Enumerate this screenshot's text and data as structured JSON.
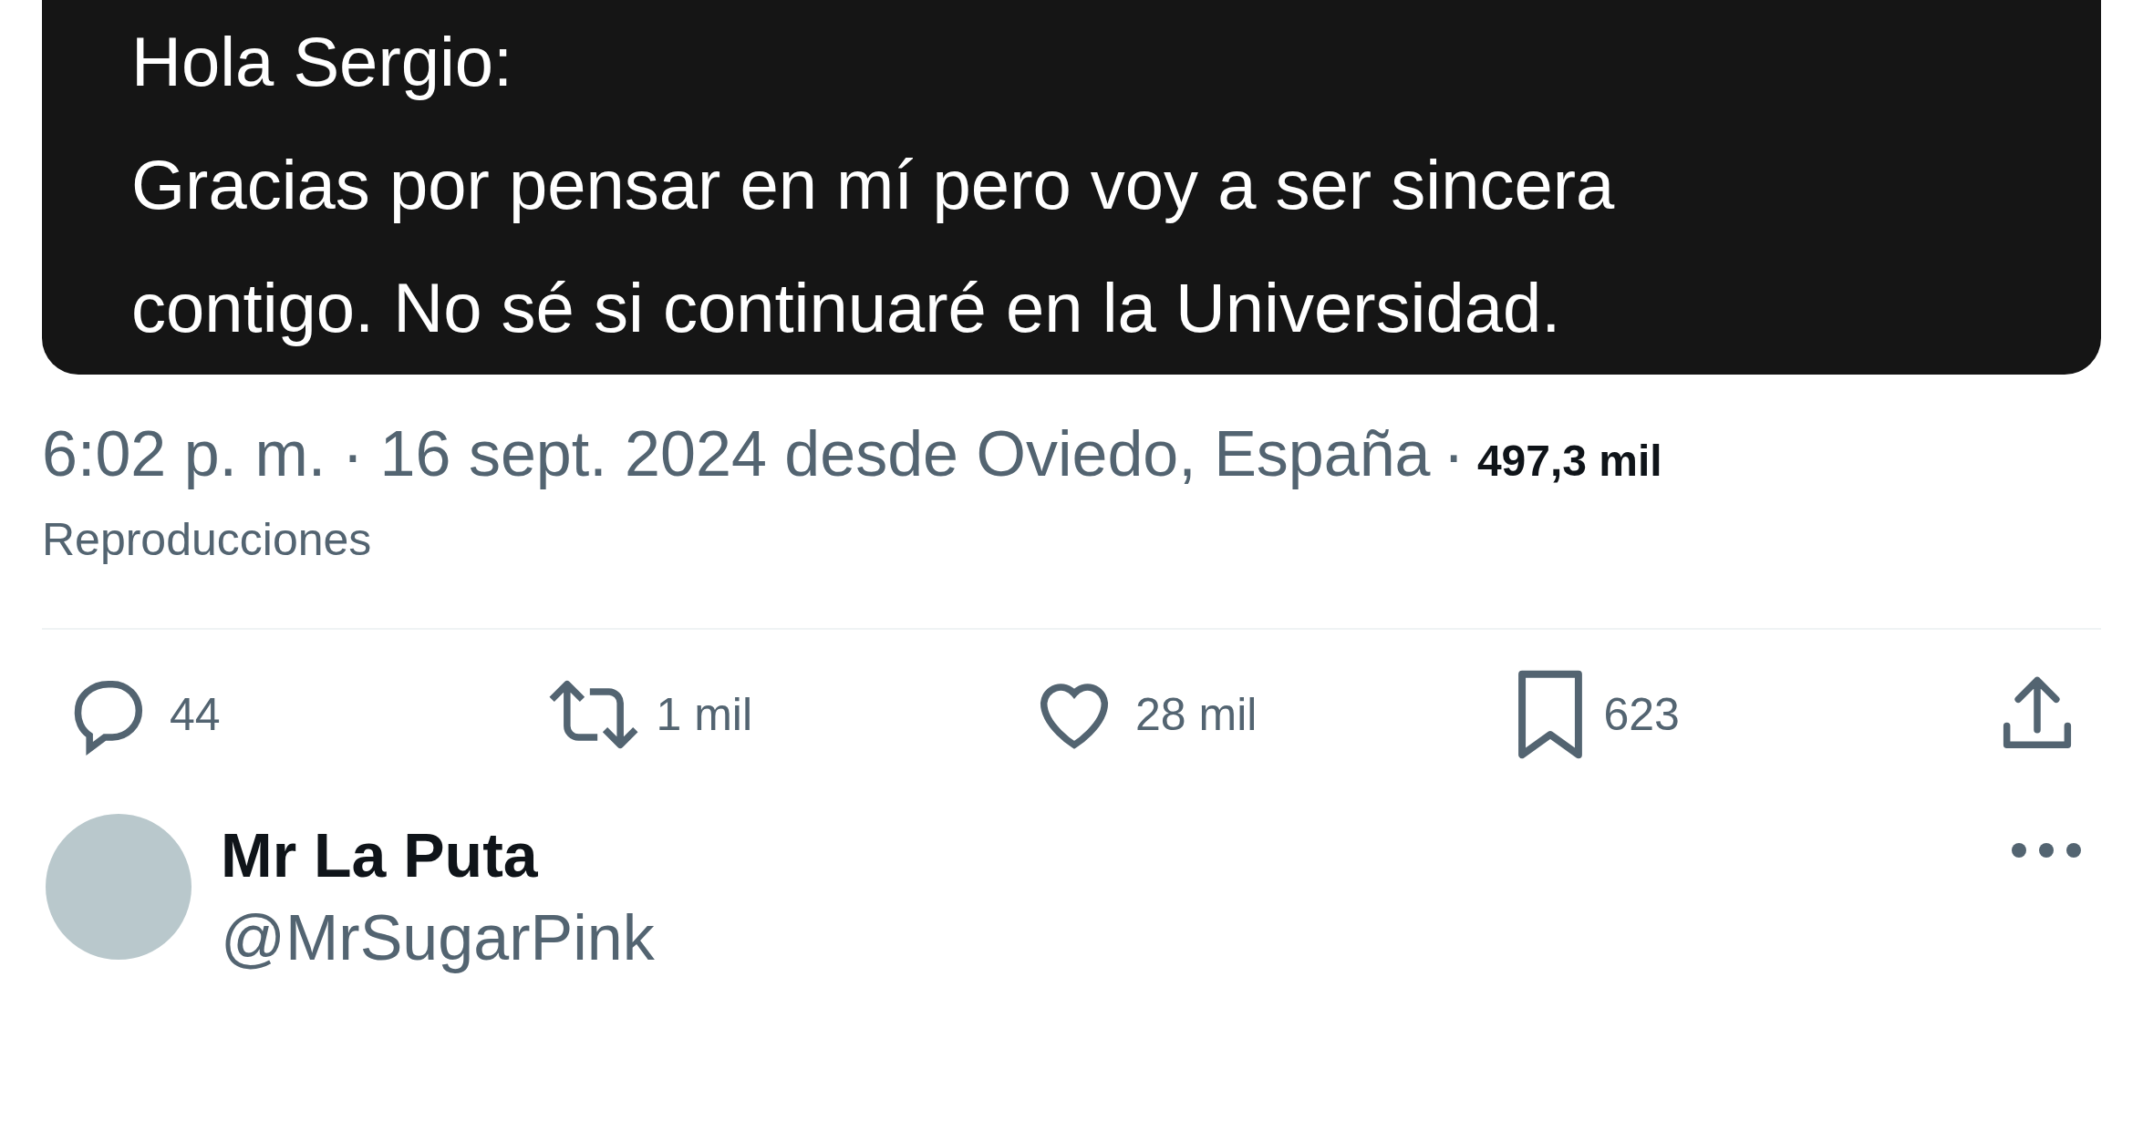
{
  "image_card": {
    "lines": [
      "Hola Sergio:",
      "Gracias por pensar en mí pero voy a ser sincera",
      "contigo. No sé si continuaré en la Universidad."
    ]
  },
  "meta": {
    "time": "6:02 p. m.",
    "date": "16 sept. 2024 desde Oviedo, España",
    "separator": "·",
    "views_count": "497,3 mil",
    "views_label": "Reproducciones"
  },
  "actions": [
    {
      "kind": "reply",
      "count": "44"
    },
    {
      "kind": "repost",
      "count": "1 mil"
    },
    {
      "kind": "like",
      "count": "28 mil"
    },
    {
      "kind": "bookmark",
      "count": "623"
    },
    {
      "kind": "share"
    }
  ],
  "reply": {
    "name": "Mr La Puta",
    "handle": "@MrSugarPink"
  }
}
